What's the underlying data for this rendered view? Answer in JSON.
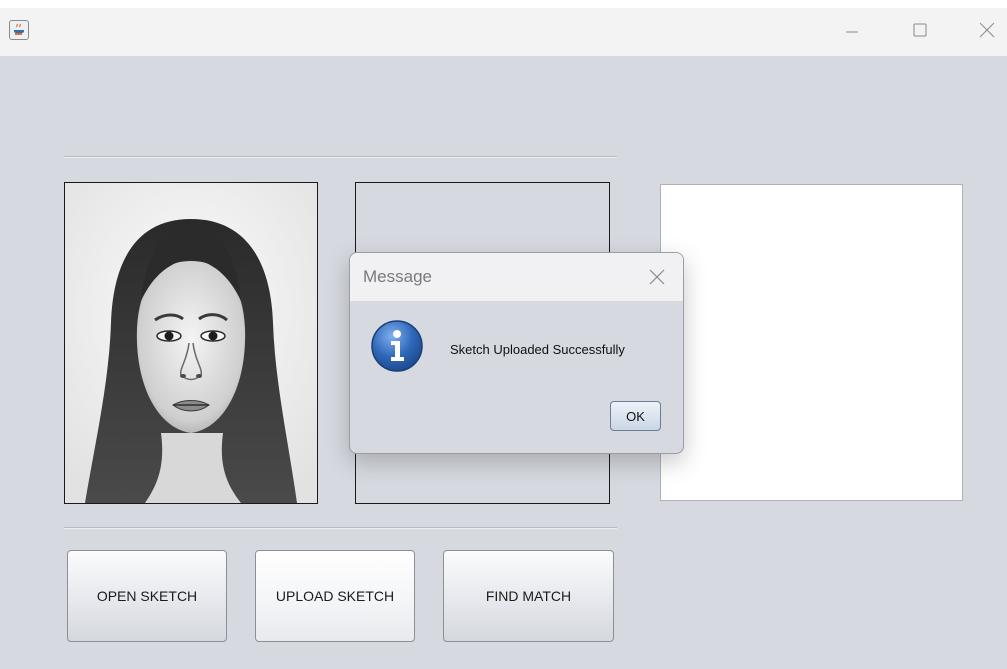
{
  "window": {
    "title": "",
    "icon": "java-cup-icon",
    "controls": [
      "minimize-icon",
      "maximize-icon",
      "close-icon"
    ]
  },
  "panels": {
    "sketch_image": "pencil-sketch-portrait",
    "uploaded": "",
    "match": ""
  },
  "buttons": {
    "open_sketch": "OPEN SKETCH",
    "upload_sketch": "UPLOAD SKETCH",
    "find_match": "FIND MATCH"
  },
  "dialog": {
    "title": "Message",
    "message": "Sketch Uploaded Successfully",
    "ok_label": "OK",
    "icon": "info-icon"
  },
  "colors": {
    "background": "#d6d9e0",
    "titlebar": "#f3f3f3",
    "info_icon": "#2f67b8"
  }
}
